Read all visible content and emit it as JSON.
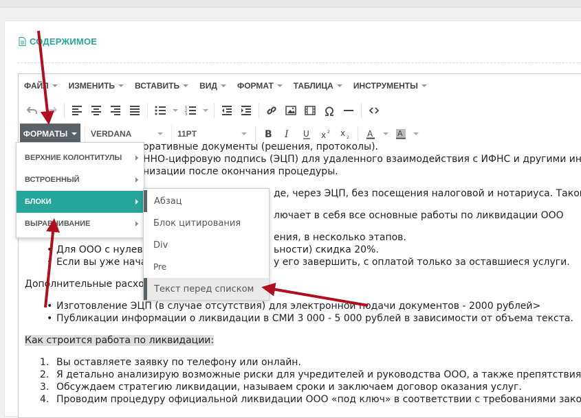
{
  "section": {
    "title": "СОДЕРЖИМОЕ",
    "icon": "document-icon"
  },
  "menubar": [
    "ФАЙЛ",
    "ИЗМЕНИТЬ",
    "ВСТАВИТЬ",
    "ВИД",
    "ФОРМАТ",
    "ТАБЛИЦА",
    "ИНСТРУМЕНТЫ"
  ],
  "toolbar2": {
    "formats": "ФОРМАТЫ",
    "font": "VERDANA",
    "size": "11PT"
  },
  "formats_menu": [
    "ВЕРХНИЕ КОЛОНТИТУЛЫ",
    "ВСТРОЕННЫЙ",
    "БЛОКИ",
    "ВЫРАВНИВАНИЕ"
  ],
  "blocks_menu": [
    "Абзац",
    "Блок цитирования",
    "Div",
    "Pre",
    "Текст перед списком"
  ],
  "content": {
    "l1": "оративные документы (решения, протоколы).",
    "l2": "ННО-цифровую подпись (ЭЦП) для удаленного взаимодействия с ИФНС и другими инст",
    "l3": "низации после окончания процедуры.",
    "l4": "де, через ЭЦП, без посещения налоговой и нотариуса. Такой с",
    "l5": "лючает в себя все основные работы по ликвидации ООО",
    "l6": "ения, в несколько этапов.",
    "l7a": "Для ООО с нулеви",
    "l7b": "ьности) скидка 20%.",
    "l8a": "Если вы уже начал",
    "l8b": "у его завершить, с оплатой только за оставшиеся услуги.",
    "l9": "Дополнительные расход",
    "b1": "Изготовление ЭЦП (в случае отсутствия) для электронной подачи документов - 2000 рублей>",
    "b2": "Публикации информации о ликвидации в СМИ 3 000 - 5 000 рублей в зависимости от объема текста.",
    "heading": "Как строится работа по ликвидации:",
    "o1": "Вы оставляете заявку по телефону или онлайн.",
    "o2": "Я детально анализирую возможные риски для учредителей и руководства ООО, а также препятствия к п",
    "o3": "Обсуждаем стратегию ликвидации, называем сроки и заключаем договор оказания услуг.",
    "o4": "Проводим процедуру официальной ликвидации ООО «под ключ» в соответствии с требованиями законо,"
  },
  "colors": {
    "accent": "#26a69a",
    "formats_bg": "#5a6268",
    "arrow": "#b0101e"
  }
}
